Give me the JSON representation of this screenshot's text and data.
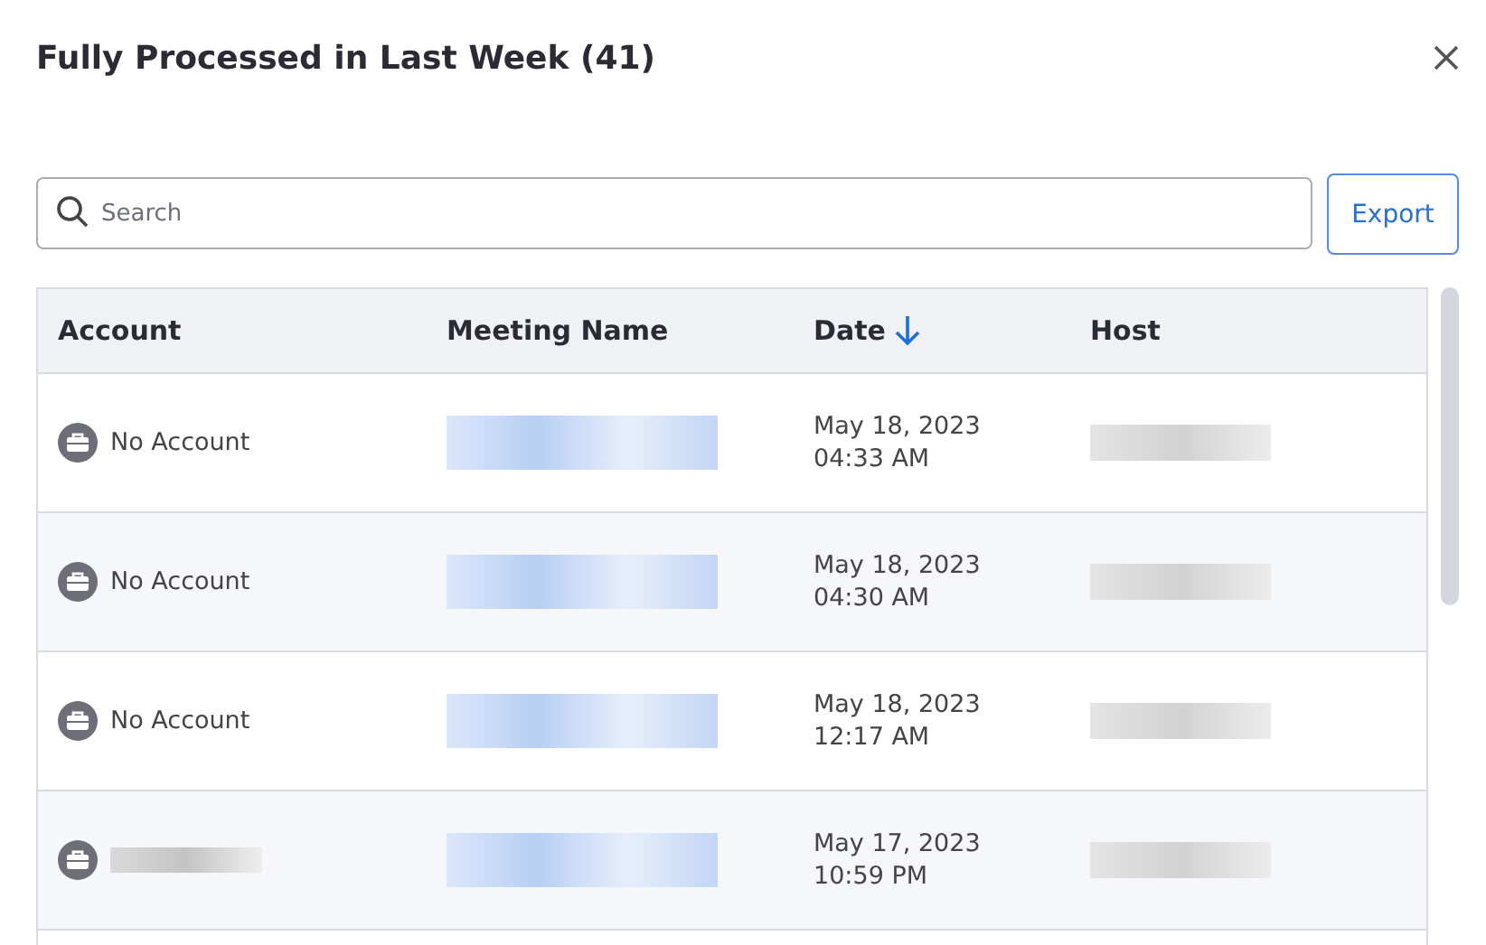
{
  "dialog": {
    "title": "Fully Processed in Last Week (41)"
  },
  "search": {
    "placeholder": "Search"
  },
  "buttons": {
    "export": "Export"
  },
  "table": {
    "columns": [
      {
        "label": "Account",
        "sorted": false
      },
      {
        "label": "Meeting Name",
        "sorted": false
      },
      {
        "label": "Date",
        "sorted": true
      },
      {
        "label": "Host",
        "sorted": false
      }
    ],
    "rows": [
      {
        "account": "No Account",
        "account_redacted": false,
        "date": "May 18, 2023",
        "time": "04:33 AM"
      },
      {
        "account": "No Account",
        "account_redacted": false,
        "date": "May 18, 2023",
        "time": "04:30 AM"
      },
      {
        "account": "No Account",
        "account_redacted": false,
        "date": "May 18, 2023",
        "time": "12:17 AM"
      },
      {
        "account_redacted": true,
        "date": "May 17, 2023",
        "time": "10:59 PM"
      }
    ]
  }
}
